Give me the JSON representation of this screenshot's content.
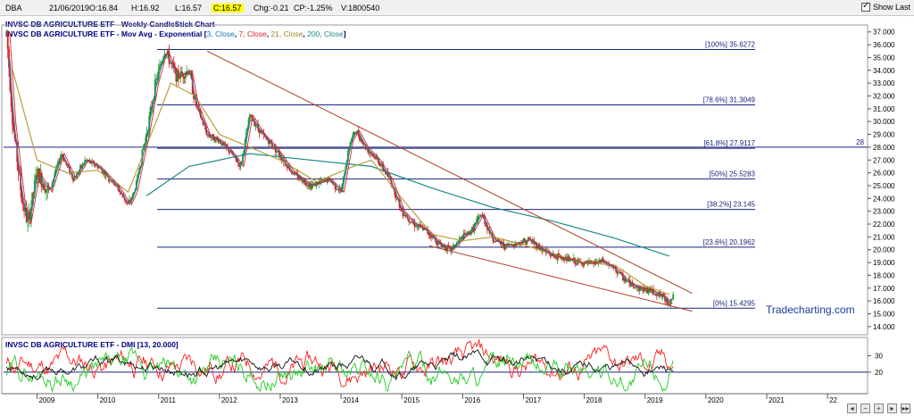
{
  "header": {
    "symbol": "DBA",
    "date": "21/06/2019",
    "open": "O:16.84",
    "high": "H:16.92",
    "low": "L:16.57",
    "close": "C:16.57",
    "change": "Chg:-0.21",
    "change_pct": "CP:-1.25%",
    "volume": "V:1800540",
    "show_last_label": "Show Last"
  },
  "main_chart": {
    "title": "INVSC DB AGRICULTURE ETF - Weekly CandleStick Chart",
    "ma_prefix": "INVSC DB AGRICULTURE ETF - Mov Avg - Exponential [",
    "ma_p1": "3, Close",
    "ma_p2": "7, Close",
    "ma_p3": "21, Close",
    "ma_p4": "200, Close",
    "ma_suffix": "]",
    "watermark": "Tradecharting.com"
  },
  "dmi_chart": {
    "title": "INVSC DB AGRICULTURE ETF - DMI [13, 20.000]"
  },
  "colors": {
    "fib_line": "#1a237e",
    "trend_line": "#b03a2e",
    "ema3": "#1f77b4",
    "ema7": "#d62728",
    "ema21": "#b8a040",
    "ema200": "#1a8a8a",
    "dmi_plus": "#22cc22",
    "dmi_minus": "#ff2020",
    "adx": "#111111"
  },
  "chart_data": {
    "type": "candlestick",
    "y_axis_ticks": [
      "37.000",
      "36.000",
      "35.000",
      "34.000",
      "33.000",
      "32.000",
      "31.000",
      "30.000",
      "29.000",
      "28.000",
      "27.000",
      "26.000",
      "25.000",
      "24.000",
      "23.000",
      "22.000",
      "21.000",
      "20.000",
      "19.000",
      "18.000",
      "17.000",
      "16.000",
      "15.000",
      "14.000"
    ],
    "ylim": [
      13.5,
      37.4
    ],
    "x_axis_labels": [
      "2009",
      "2010",
      "2011",
      "2012",
      "2013",
      "2014",
      "2015",
      "2016",
      "2017",
      "2018",
      "2019",
      "2020",
      "2021",
      "22"
    ],
    "fib_levels": [
      {
        "label": "[100%] 35.6272",
        "value": 35.6272
      },
      {
        "label": "[78.6%] 31.3049",
        "value": 31.3049
      },
      {
        "label": "[61.8%] 27.9117",
        "value": 27.9117
      },
      {
        "label": "[50%] 25.5283",
        "value": 25.5283
      },
      {
        "label": "[38.2%] 23.145",
        "value": 23.145
      },
      {
        "label": "[23.6%] 20.1962",
        "value": 20.1962
      },
      {
        "label": "[0%] 15.4295",
        "value": 15.4295
      }
    ],
    "horizontal_line": {
      "label": "28",
      "value": 28.0
    },
    "price_series": [
      [
        2008.5,
        37.0
      ],
      [
        2008.6,
        30.0
      ],
      [
        2008.75,
        24.0
      ],
      [
        2008.85,
        22.0
      ],
      [
        2009.0,
        26.0
      ],
      [
        2009.2,
        24.5
      ],
      [
        2009.4,
        27.5
      ],
      [
        2009.6,
        25.5
      ],
      [
        2009.8,
        27.0
      ],
      [
        2010.0,
        26.5
      ],
      [
        2010.3,
        25.0
      ],
      [
        2010.5,
        23.5
      ],
      [
        2010.6,
        24.5
      ],
      [
        2010.8,
        29.0
      ],
      [
        2010.95,
        33.0
      ],
      [
        2011.1,
        35.6
      ],
      [
        2011.3,
        33.5
      ],
      [
        2011.5,
        34.0
      ],
      [
        2011.6,
        31.5
      ],
      [
        2011.8,
        29.0
      ],
      [
        2012.0,
        28.5
      ],
      [
        2012.2,
        27.5
      ],
      [
        2012.35,
        26.5
      ],
      [
        2012.5,
        30.5
      ],
      [
        2012.7,
        29.0
      ],
      [
        2012.9,
        28.0
      ],
      [
        2013.2,
        26.0
      ],
      [
        2013.5,
        25.0
      ],
      [
        2013.8,
        25.5
      ],
      [
        2014.0,
        24.5
      ],
      [
        2014.15,
        28.5
      ],
      [
        2014.25,
        29.3
      ],
      [
        2014.4,
        28.0
      ],
      [
        2014.6,
        27.0
      ],
      [
        2014.8,
        25.5
      ],
      [
        2015.0,
        23.0
      ],
      [
        2015.2,
        22.0
      ],
      [
        2015.4,
        21.5
      ],
      [
        2015.6,
        20.5
      ],
      [
        2015.8,
        20.0
      ],
      [
        2016.0,
        21.0
      ],
      [
        2016.15,
        21.5
      ],
      [
        2016.3,
        22.8
      ],
      [
        2016.5,
        20.8
      ],
      [
        2016.7,
        20.3
      ],
      [
        2016.9,
        20.5
      ],
      [
        2017.1,
        20.8
      ],
      [
        2017.3,
        20.0
      ],
      [
        2017.5,
        19.5
      ],
      [
        2017.7,
        19.3
      ],
      [
        2017.9,
        19.0
      ],
      [
        2018.1,
        18.9
      ],
      [
        2018.3,
        19.1
      ],
      [
        2018.5,
        18.5
      ],
      [
        2018.7,
        17.5
      ],
      [
        2018.9,
        17.0
      ],
      [
        2019.1,
        16.8
      ],
      [
        2019.3,
        16.3
      ],
      [
        2019.4,
        15.8
      ],
      [
        2019.47,
        16.6
      ]
    ],
    "ema_series": [
      {
        "name": "200, Close",
        "points": [
          [
            2010.8,
            24.2
          ],
          [
            2011.5,
            26.5
          ],
          [
            2012.5,
            27.5
          ],
          [
            2013.5,
            27.0
          ],
          [
            2014.5,
            26.5
          ],
          [
            2015.5,
            24.8
          ],
          [
            2016.5,
            23.3
          ],
          [
            2017.5,
            22.2
          ],
          [
            2018.5,
            20.9
          ],
          [
            2019.4,
            19.5
          ]
        ]
      },
      {
        "name": "21, Close",
        "points": [
          [
            2008.6,
            34.0
          ],
          [
            2009.0,
            27.0
          ],
          [
            2009.5,
            26.0
          ],
          [
            2010.0,
            26.2
          ],
          [
            2010.5,
            24.5
          ],
          [
            2011.0,
            30.5
          ],
          [
            2011.2,
            33.0
          ],
          [
            2011.6,
            32.0
          ],
          [
            2012.0,
            29.0
          ],
          [
            2012.5,
            28.0
          ],
          [
            2013.0,
            27.0
          ],
          [
            2013.6,
            25.3
          ],
          [
            2014.2,
            26.5
          ],
          [
            2014.5,
            27.0
          ],
          [
            2015.0,
            24.0
          ],
          [
            2015.5,
            21.2
          ],
          [
            2016.0,
            20.7
          ],
          [
            2016.5,
            21.0
          ],
          [
            2017.0,
            20.4
          ],
          [
            2017.5,
            19.6
          ],
          [
            2018.0,
            19.0
          ],
          [
            2018.5,
            18.8
          ],
          [
            2019.0,
            17.2
          ],
          [
            2019.4,
            16.5
          ]
        ]
      }
    ],
    "trend_lines": [
      {
        "from": [
          2011.8,
          35.5
        ],
        "to": [
          2019.45,
          16.6
        ]
      },
      {
        "from": [
          2015.45,
          20.3
        ],
        "to": [
          2019.45,
          15.2
        ]
      }
    ],
    "dmi": {
      "yticks": [
        "30",
        "20"
      ],
      "ylim": [
        8,
        40
      ],
      "reference_line": 20
    }
  }
}
